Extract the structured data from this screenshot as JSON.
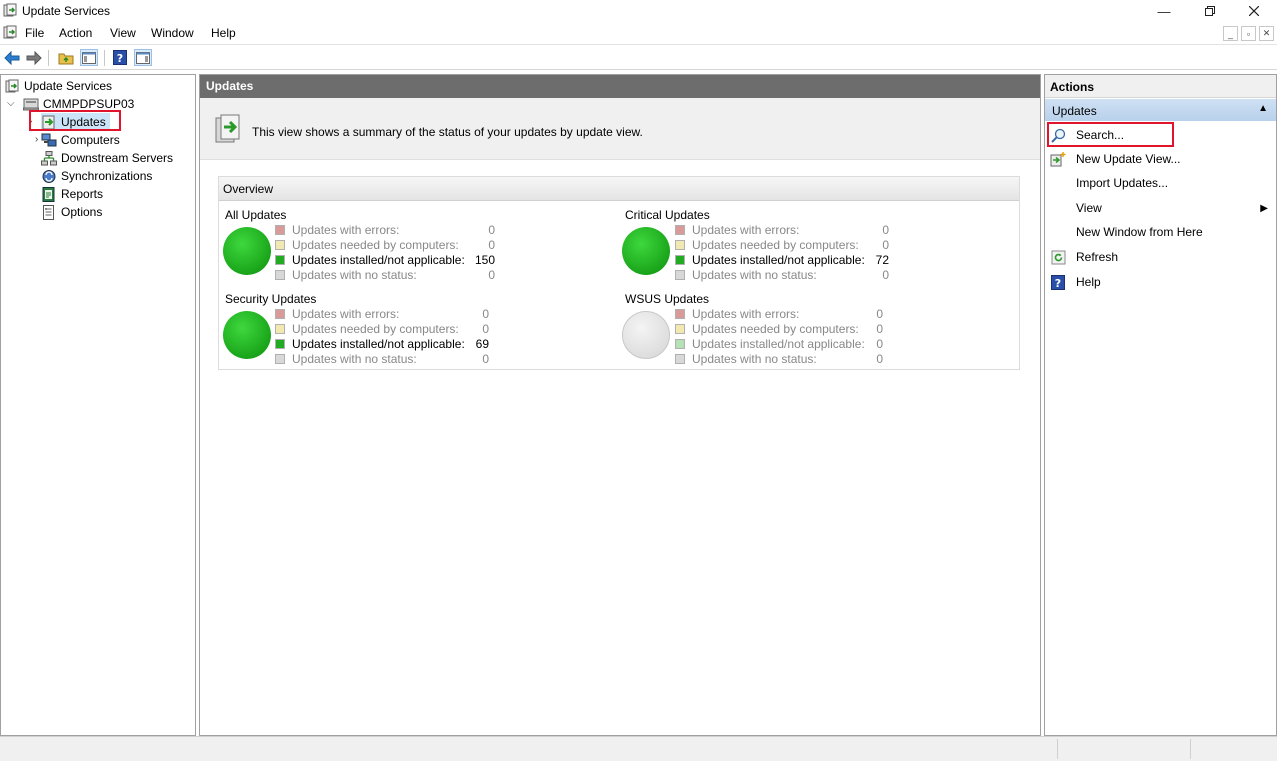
{
  "window": {
    "title": "Update Services"
  },
  "menu": {
    "file": "File",
    "action": "Action",
    "view": "View",
    "window": "Window",
    "help": "Help"
  },
  "tree": {
    "root": "Update Services",
    "server": "CMMPDPSUP03",
    "items": [
      "Updates",
      "Computers",
      "Downstream Servers",
      "Synchronizations",
      "Reports",
      "Options"
    ]
  },
  "center": {
    "header": "Updates",
    "summary": "This view shows a summary of the status of your updates by update view.",
    "overview_title": "Overview",
    "stat_labels": {
      "errors": "Updates with errors:",
      "needed": "Updates needed by computers:",
      "installed": "Updates installed/not applicable:",
      "nostatus": "Updates with no status:"
    },
    "groups": [
      {
        "title": "All Updates",
        "errors": "0",
        "needed": "0",
        "installed": "150",
        "nostatus": "0"
      },
      {
        "title": "Critical Updates",
        "errors": "0",
        "needed": "0",
        "installed": "72",
        "nostatus": "0"
      },
      {
        "title": "Security Updates",
        "errors": "0",
        "needed": "0",
        "installed": "69",
        "nostatus": "0"
      },
      {
        "title": "WSUS Updates",
        "errors": "0",
        "needed": "0",
        "installed": "0",
        "nostatus": "0"
      }
    ]
  },
  "actions": {
    "header": "Actions",
    "section": "Updates",
    "items": [
      "Search...",
      "New Update View...",
      "Import Updates...",
      "View",
      "New Window from Here",
      "Refresh",
      "Help"
    ]
  },
  "colors": {
    "highlight_box": "#e0142a",
    "center_header_bg": "#6d6d6d",
    "action_section_bg": "#c5d9f1",
    "status_green": "#1aa51a"
  }
}
